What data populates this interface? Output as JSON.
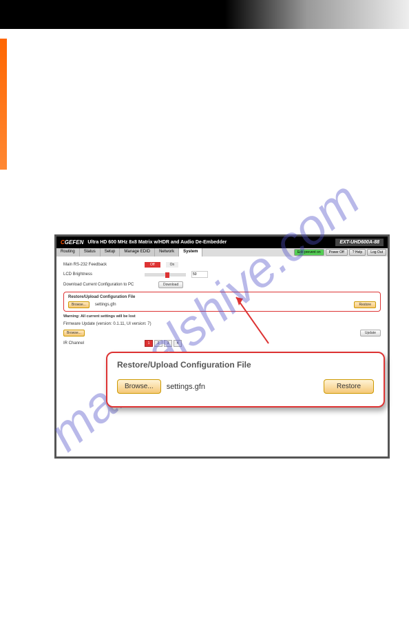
{
  "watermark": "manualshive.com",
  "header": {
    "logo": "GEFEN",
    "title": "Ultra HD 600 MHz 8x8 Matrix w/HDR and Audio De-Embedder",
    "model": "EXT-UHD600A-88"
  },
  "tabs": [
    "Routing",
    "Status",
    "Setup",
    "Manage EDID",
    "Network",
    "System"
  ],
  "header_buttons": {
    "edit": "Edit prevent on",
    "power": "Power Off",
    "help": "? Help",
    "logout": "Log Out"
  },
  "settings": {
    "rs232_label": "Main RS-232 Feedback",
    "off": "Off",
    "on": "On",
    "lcd_label": "LCD Brightness",
    "lcd_value": "50",
    "download_label": "Download Current Configuration to PC",
    "download_btn": "Download",
    "restore_title": "Restore/Upload Configuration File",
    "browse_btn": "Browse...",
    "filename": "settings.gfn",
    "restore_btn": "Restore",
    "warning": "Warning: All current settings will be lost",
    "fw_label": "Firmware Update (version: 0.1.11, UI version: 7)",
    "update_btn": "Update",
    "ir_label": "IR Channel",
    "ir_channels": [
      "1",
      "2",
      "3",
      "4"
    ]
  },
  "callout": {
    "title": "Restore/Upload Configuration File",
    "browse": "Browse...",
    "filename": "settings.gfn",
    "restore": "Restore"
  }
}
